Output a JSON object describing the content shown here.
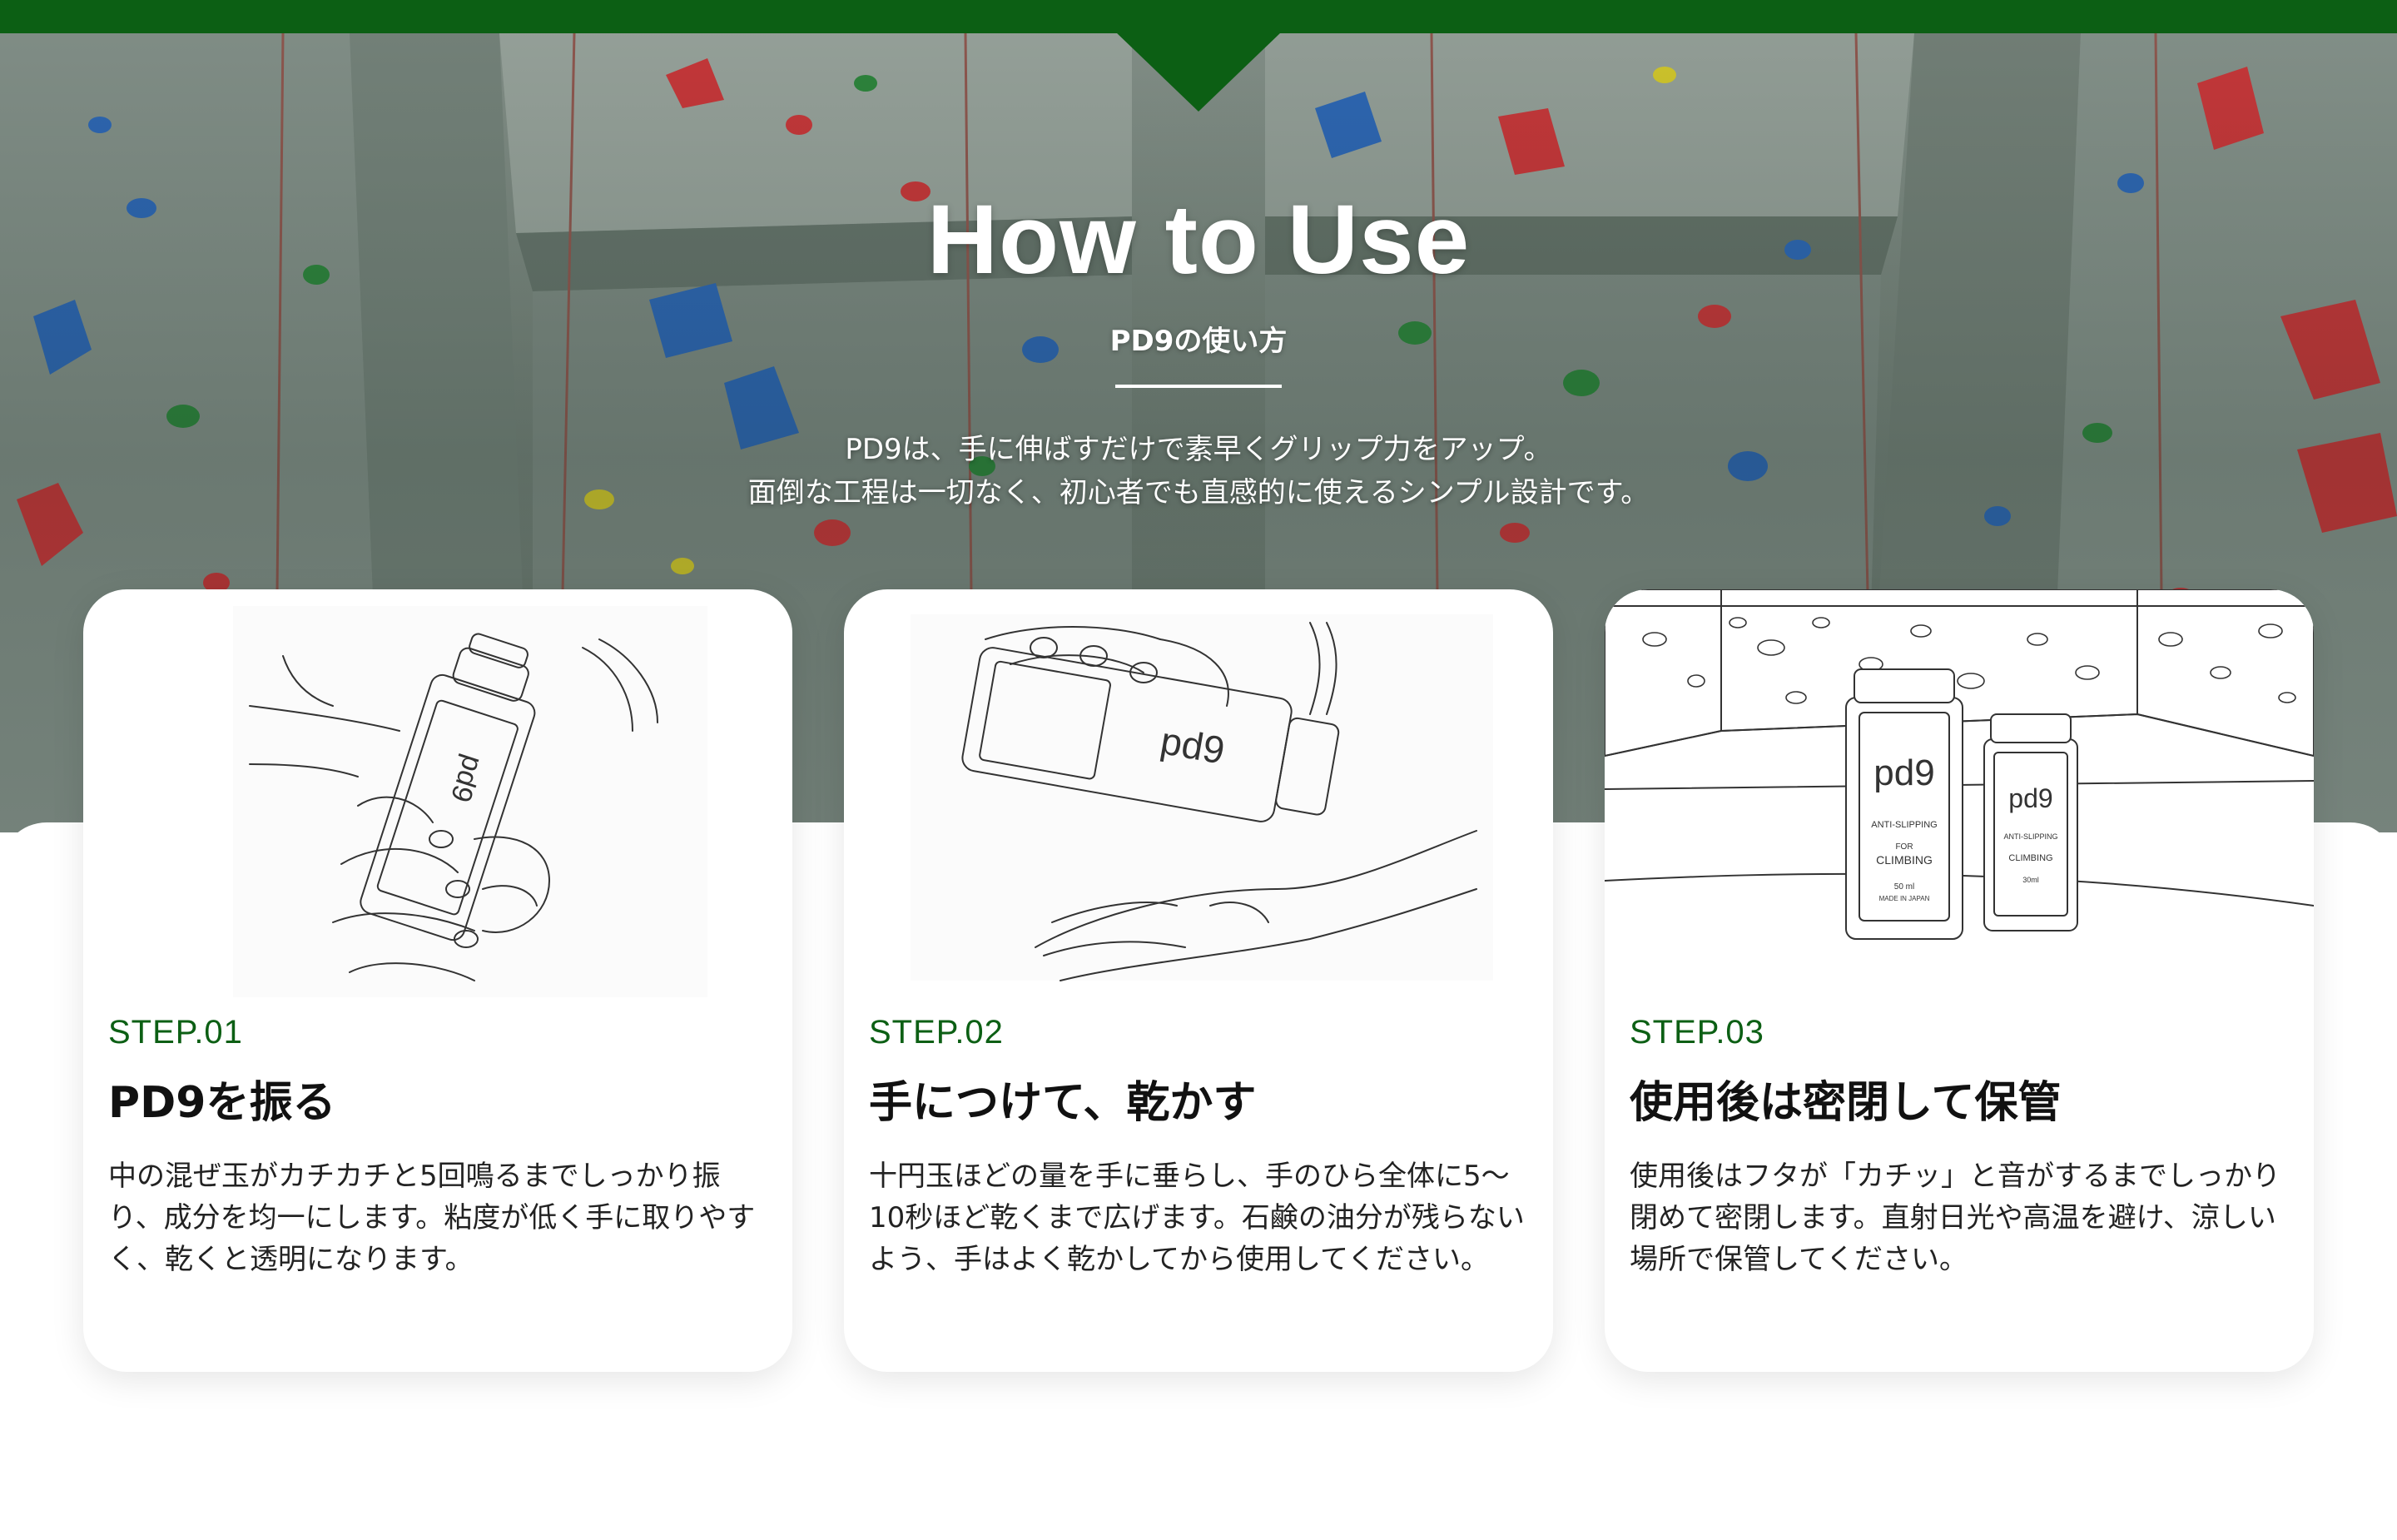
{
  "hero": {
    "title": "How to Use",
    "subtitle": "PD9の使い方",
    "description_line_1": "PD9は、手に伸ばすだけで素早くグリップ力をアップ。",
    "description_line_2": "面倒な工程は一切なく、初心者でも直感的に使えるシンプル設計です。"
  },
  "colors": {
    "brand_green": "#0c5f14",
    "hold_red": "#d8373b",
    "hold_blue": "#2f6cc2",
    "hold_green": "#2f8d3e",
    "hold_yellow": "#e3d52c"
  },
  "steps": [
    {
      "label": "STEP.01",
      "title": "PD9を振る",
      "body": "中の混ぜ玉がカチカチと5回鳴るまでしっかり振り、成分を均一にします。粘度が低く手に取りやすく、乾くと透明になります。",
      "illustration": "shaking-bottle-drawing"
    },
    {
      "label": "STEP.02",
      "title": "手につけて、乾かす",
      "body": "十円玉ほどの量を手に垂らし、手のひら全体に5〜10秒ほど乾くまで広げます。石鹸の油分が残らないよう、手はよく乾かしてから使用してください。",
      "illustration": "pouring-on-hand-drawing"
    },
    {
      "label": "STEP.03",
      "title": "使用後は密閉して保管",
      "body": "使用後はフタが「カチッ」と音がするまでしっかり閉めて密閉します。直射日光や高温を避け、涼しい場所で保管してください。",
      "illustration": "two-bottles-at-gym-drawing",
      "bottle_texts": {
        "logo": "pd9",
        "tagline": "ANTI-SLIPPING",
        "for": "FOR",
        "product": "CLIMBING",
        "volume_large": "50 ml",
        "volume_small": "30ml",
        "origin": "MADE IN JAPAN"
      }
    }
  ]
}
